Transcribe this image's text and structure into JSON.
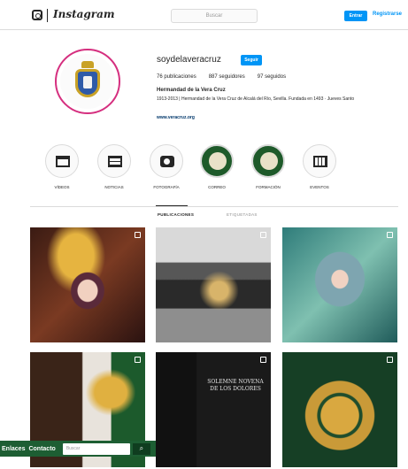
{
  "topbar": {
    "brand": "Instagram",
    "search_placeholder": "Buscar",
    "login": "Entrar",
    "signup": "Registrarse"
  },
  "profile": {
    "username": "soydelaveracruz",
    "follow": "Seguir",
    "stats": {
      "posts": "76 publicaciones",
      "followers": "887 seguidores",
      "following": "97 seguidos"
    },
    "name": "Hermandad de la Vera Cruz",
    "bio": "1913-2013 | Hermandad de la Vera Cruz de Alcalá del Río, Sevilla. Fundada en 1493 · Jueves Santo",
    "link": "www.veracruz.org"
  },
  "highlights": [
    {
      "label": "VÍDEOS",
      "icon": "video-icon"
    },
    {
      "label": "NOTICIAS",
      "icon": "news-icon"
    },
    {
      "label": "FOTOGRAFÍA",
      "icon": "camera-icon"
    },
    {
      "label": "CORREO",
      "icon": "crest-icon"
    },
    {
      "label": "FORMACIÓN",
      "icon": "crest-icon"
    },
    {
      "label": "EVENTOS",
      "icon": "calendar-icon"
    }
  ],
  "tabs": {
    "posts": "PUBLICACIONES",
    "tagged": "ETIQUETADAS"
  },
  "posts": {
    "t5_caption": "SOLEMNE NOVENA DE LOS DOLORES"
  },
  "webbar": {
    "link1": "Enlaces",
    "link2": "Contacto",
    "search_placeholder": "Buscar",
    "search_button": "⌕"
  },
  "colors": {
    "accent": "#0095f6",
    "avatar_ring": "#d52f7f",
    "webbar_bg": "#1d5e33"
  }
}
